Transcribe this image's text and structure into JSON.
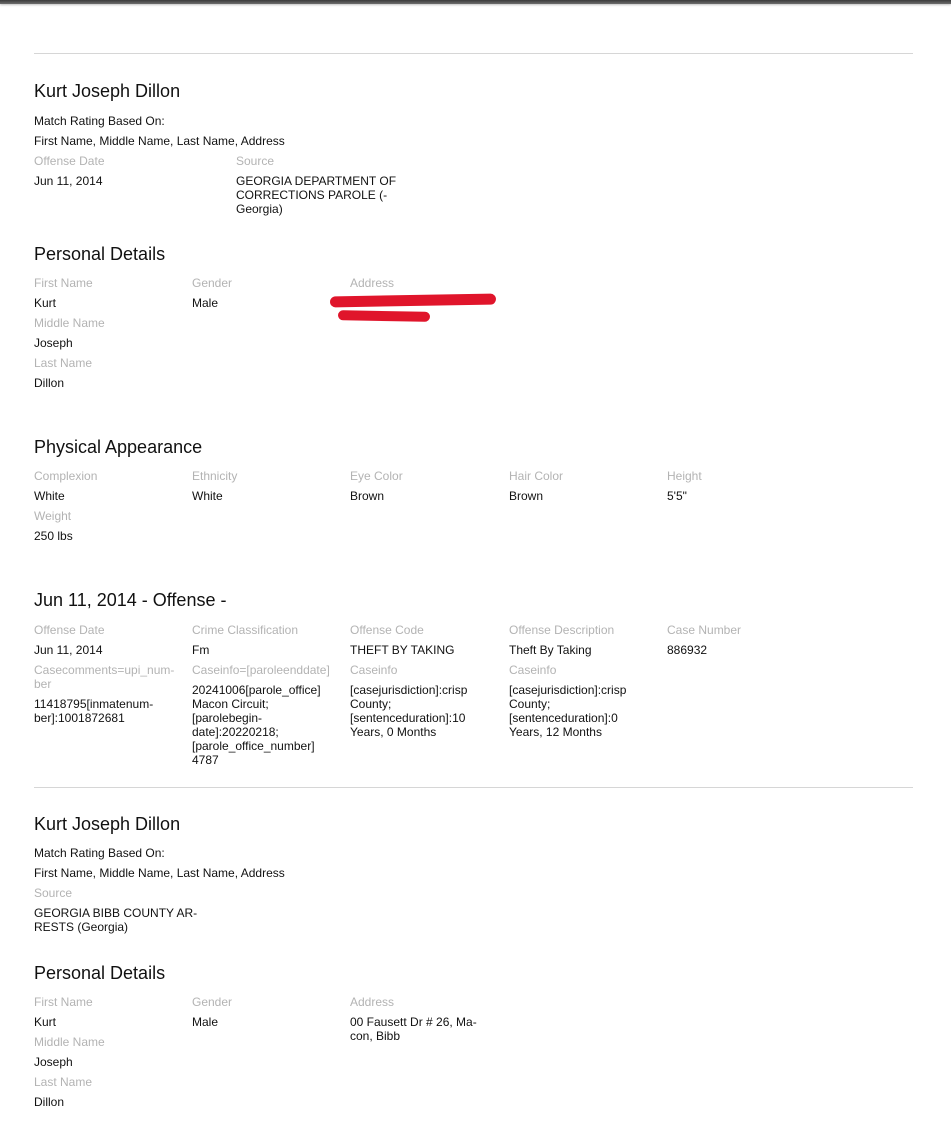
{
  "record1": {
    "name": "Kurt Joseph Dillon",
    "match_rating_label": "Match Rating Based On:",
    "match_rating_value": "First Name, Middle Name, Last Name, Address",
    "offense_date_label": "Offense Date",
    "offense_date": "Jun 11, 2014",
    "source_label": "Source",
    "source_line1": "GEORGIA DEPARTMENT OF",
    "source_line2": "CORRECTIONS PAROLE (-",
    "source_line3": "Georgia)",
    "personal": {
      "heading": "Personal Details",
      "first_name_label": "First Name",
      "first_name": "Kurt",
      "gender_label": "Gender",
      "gender": "Male",
      "address_label": "Address",
      "middle_name_label": "Middle Name",
      "middle_name": "Joseph",
      "last_name_label": "Last Name",
      "last_name": "Dillon"
    },
    "physical": {
      "heading": "Physical Appearance",
      "complexion_label": "Complexion",
      "complexion": "White",
      "ethnicity_label": "Ethnicity",
      "ethnicity": "White",
      "eye_color_label": "Eye Color",
      "eye_color": "Brown",
      "hair_color_label": "Hair Color",
      "hair_color": "Brown",
      "height_label": "Height",
      "height": "5'5\"",
      "weight_label": "Weight",
      "weight": "250 lbs"
    },
    "offense": {
      "heading": "Jun 11, 2014 - Offense -",
      "offense_date_label": "Offense Date",
      "offense_date": "Jun 11, 2014",
      "crime_class_label": "Crime Classification",
      "crime_class": "Fm",
      "offense_code_label": "Offense Code",
      "offense_code": "THEFT BY TAKING",
      "offense_desc_label": "Offense Description",
      "offense_desc": "Theft By Taking",
      "case_number_label": "Case Number",
      "case_number": "886932",
      "casecomments_label_1": "Casecomments=upi_num-",
      "casecomments_label_2": "ber",
      "casecomments_value_1": "11418795[inmatenum-",
      "casecomments_value_2": "ber]:1001872681",
      "caseinfo1_label": "Caseinfo=[paroleenddate]",
      "caseinfo1_l1": "20241006[parole_office]",
      "caseinfo1_l2": "Macon Circuit;",
      "caseinfo1_l3": "[parolebegin-",
      "caseinfo1_l4": "date]:20220218;",
      "caseinfo1_l5": "[parole_office_number]",
      "caseinfo1_l6": "4787",
      "caseinfo2_label": "Caseinfo",
      "caseinfo2_l1": "[casejurisdiction]:crisp",
      "caseinfo2_l2": "County;",
      "caseinfo2_l3": "[sentenceduration]:10",
      "caseinfo2_l4": "Years, 0 Months",
      "caseinfo3_label": "Caseinfo",
      "caseinfo3_l1": "[casejurisdiction]:crisp",
      "caseinfo3_l2": "County;",
      "caseinfo3_l3": "[sentenceduration]:0",
      "caseinfo3_l4": "Years, 12 Months"
    }
  },
  "record2": {
    "name": "Kurt Joseph Dillon",
    "match_rating_label": "Match Rating Based On:",
    "match_rating_value": "First Name, Middle Name, Last Name, Address",
    "source_label": "Source",
    "source_line1": "GEORGIA BIBB COUNTY AR-",
    "source_line2": "RESTS (Georgia)",
    "personal": {
      "heading": "Personal Details",
      "first_name_label": "First Name",
      "first_name": "Kurt",
      "gender_label": "Gender",
      "gender": "Male",
      "address_label": "Address",
      "address_line1": "00 Fausett Dr # 26, Ma-",
      "address_line2": "con, Bibb",
      "middle_name_label": "Middle Name",
      "middle_name": "Joseph",
      "last_name_label": "Last Name",
      "last_name": "Dillon"
    }
  }
}
